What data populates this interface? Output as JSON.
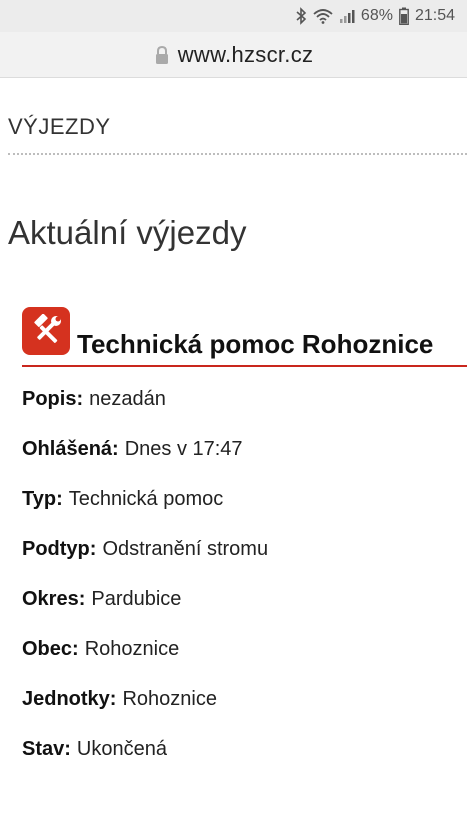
{
  "status_bar": {
    "battery_percent": "68%",
    "time": "21:54",
    "icons": [
      "bluetooth-icon",
      "wifi-icon",
      "signal-icon",
      "battery-icon"
    ]
  },
  "browser": {
    "url": "www.hzscr.cz",
    "icon": "lock-icon"
  },
  "page": {
    "section_label": "VÝJEZDY",
    "title": "Aktuální výjezdy"
  },
  "incident": {
    "icon": "tools-icon",
    "icon_color": "#d5321f",
    "accent_color": "#c9261d",
    "title": "Technická pomoc Rohoznice",
    "details": [
      {
        "label": "Popis:",
        "value": "nezadán"
      },
      {
        "label": "Ohlášená:",
        "value": "Dnes v 17:47"
      },
      {
        "label": "Typ:",
        "value": "Technická pomoc"
      },
      {
        "label": "Podtyp:",
        "value": "Odstranění stromu"
      },
      {
        "label": "Okres:",
        "value": "Pardubice"
      },
      {
        "label": "Obec:",
        "value": "Rohoznice"
      },
      {
        "label": "Jednotky:",
        "value": "Rohoznice"
      },
      {
        "label": "Stav:",
        "value": "Ukončená"
      }
    ]
  }
}
